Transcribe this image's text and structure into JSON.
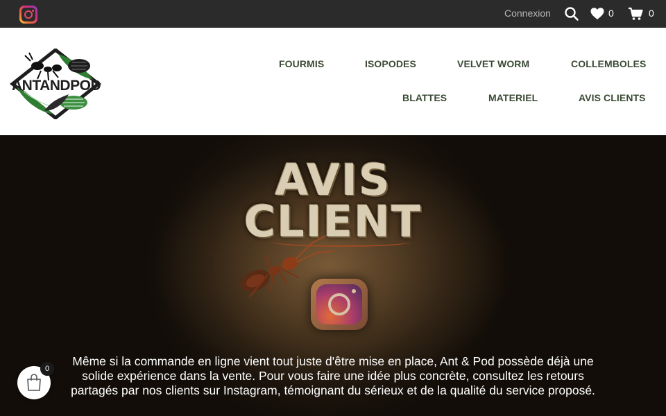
{
  "topbar": {
    "instagram_icon": "instagram-icon",
    "connexion_label": "Connexion",
    "search_icon": "search-icon",
    "wishlist_icon": "heart-icon",
    "wishlist_count": "0",
    "cart_icon": "cart-icon",
    "cart_count": "0"
  },
  "header": {
    "logo_text": "ANTANDPOD",
    "nav": {
      "fourmis": "FOURMIS",
      "isopodes": "ISOPODES",
      "velvet_worm": "VELVET WORM",
      "collemboles": "COLLEMBOLES",
      "blattes": "BLATTES",
      "materiel": "MATERIEL",
      "avis_clients": "AVIS CLIENTS"
    }
  },
  "hero": {
    "title_line1": "AVIS",
    "title_line2": "CLIENT",
    "description": "Même si la commande en ligne vient tout juste d'être mise en place,  Ant & Pod possède déjà une solide expérience dans la vente. Pour vous faire une idée plus concrète, consultez les retours partagés par nos clients sur Instagram, témoignant du sérieux et de la qualité du service proposé."
  },
  "floating_cart": {
    "icon": "shopping-bag-icon",
    "count": "0"
  },
  "colors": {
    "topbar_bg": "#2b2b2b",
    "nav_text": "#3a4a34",
    "logo_green": "#2e7d32"
  }
}
